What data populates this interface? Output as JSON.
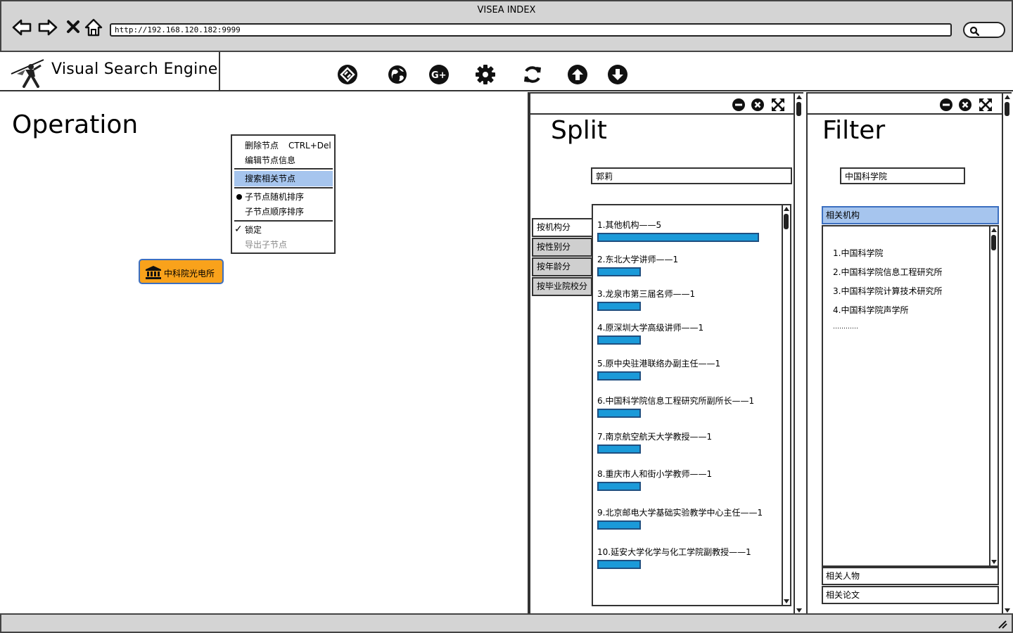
{
  "window": {
    "title": "VISEA INDEX"
  },
  "browser": {
    "url": "http://192.168.120.182:9999",
    "nav_icons": [
      "back-arrow-icon",
      "forward-arrow-icon",
      "close-x-icon",
      "home-icon",
      "search-icon"
    ]
  },
  "app": {
    "brand": "Visual Search Engine",
    "toolbar_icons": [
      "share-icon",
      "globe-icon",
      "google-plus-icon",
      "gear-icon",
      "refresh-icon",
      "arrow-up-circle-icon",
      "arrow-down-circle-icon"
    ]
  },
  "operation": {
    "title": "Operation",
    "context_menu": {
      "delete_label": "删除节点",
      "delete_shortcut": "CTRL+Del",
      "edit_label": "编辑节点信息",
      "search_label": "搜索相关节点",
      "random_sort_label": "子节点随机排序",
      "order_sort_label": "子节点顺序排序",
      "lock_label": "锁定",
      "export_label": "导出子节点"
    },
    "node": {
      "label": "中科院光电所",
      "icon": "institution-icon"
    }
  },
  "split": {
    "title": "Split",
    "search_value": "郭莉",
    "tabs": [
      "按机构分",
      "按性别分",
      "按年龄分",
      "按毕业院校分"
    ],
    "items": [
      {
        "label": "1.其他机构——5",
        "value": 5
      },
      {
        "label": "2.东北大学讲师——1",
        "value": 1
      },
      {
        "label": "3.龙泉市第三届名师——1",
        "value": 1
      },
      {
        "label": "4.原深圳大学高级讲师——1",
        "value": 1
      },
      {
        "label": "5.原中央驻港联络办副主任——1",
        "value": 1
      },
      {
        "label": "6.中国科学院信息工程研究所副所长——1",
        "value": 1
      },
      {
        "label": "7.南京航空航天大学教授——1",
        "value": 1
      },
      {
        "label": "8.重庆市人和街小学教师——1",
        "value": 1
      },
      {
        "label": "9.北京邮电大学基础实验教学中心主任——1",
        "value": 1
      },
      {
        "label": "10.延安大学化学与化工学院副教授——1",
        "value": 1
      }
    ],
    "bar_color": "#1a9ad9"
  },
  "filter": {
    "title": "Filter",
    "search_value": "中国科学院",
    "sections": [
      "相关机构",
      "相关人物",
      "相关论文"
    ],
    "items": [
      "1.中国科学院",
      "2.中国科学院信息工程研究所",
      "3.中国科学院计算技术研究所",
      "4.中国科学院声学所",
      "…………"
    ]
  },
  "colors": {
    "selected": "#a6c5ee",
    "node_fill": "#f9a21b",
    "node_border": "#3c6fc0"
  }
}
